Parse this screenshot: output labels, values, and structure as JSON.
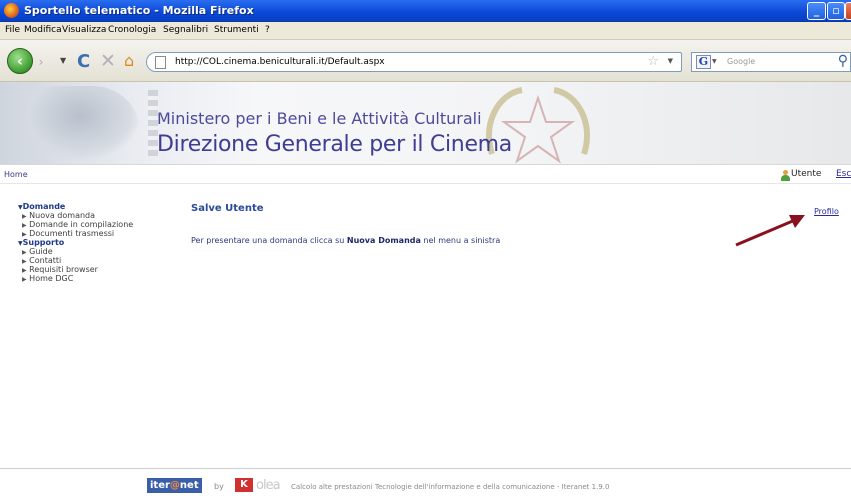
{
  "window": {
    "title": "Sportello telematico - Mozilla Firefox"
  },
  "menu": {
    "items": [
      "File",
      "Modifica",
      "Visualizza",
      "Cronologia",
      "Segnalibri",
      "Strumenti",
      "?"
    ]
  },
  "toolbar": {
    "url": "http://COL.cinema.beniculturali.it/Default.aspx",
    "search_placeholder": "Google",
    "search_engine_letter": "G"
  },
  "banner": {
    "ministry": "Ministero per i Beni e le Attività Culturali",
    "direzione": "Direzione Generale per il Cinema"
  },
  "breadcrumb": {
    "home": "Home",
    "user_label": "Utente",
    "exit_label": "Esc"
  },
  "sidebar": {
    "sections": [
      {
        "label": "Domande",
        "items": [
          "Nuova domanda",
          "Domande in compilazione",
          "Documenti trasmessi"
        ]
      },
      {
        "label": "Supporto",
        "items": [
          "Guide",
          "Contatti",
          "Requisiti browser",
          "Home DGC"
        ]
      }
    ]
  },
  "main": {
    "title": "Salve Utente",
    "message_pre": "Per presentare una domanda clicca su ",
    "message_bold": "Nuova Domanda",
    "message_post": " nel menu a sinistra",
    "profile_link": "Profilo"
  },
  "footer": {
    "logo_iter": "iter",
    "logo_at": "@",
    "logo_net": "net",
    "by": "by",
    "logo2_mark": "K",
    "logo2_text": "olea",
    "credits": "Calcolo alte prestazioni Tecnologie dell'informazione e della comunicazione - Iteranet 1.9.0"
  },
  "colors": {
    "titlebar": "#0a48d6",
    "banner_text": "#3f3c93",
    "annotation_arrow": "#8a1020"
  }
}
